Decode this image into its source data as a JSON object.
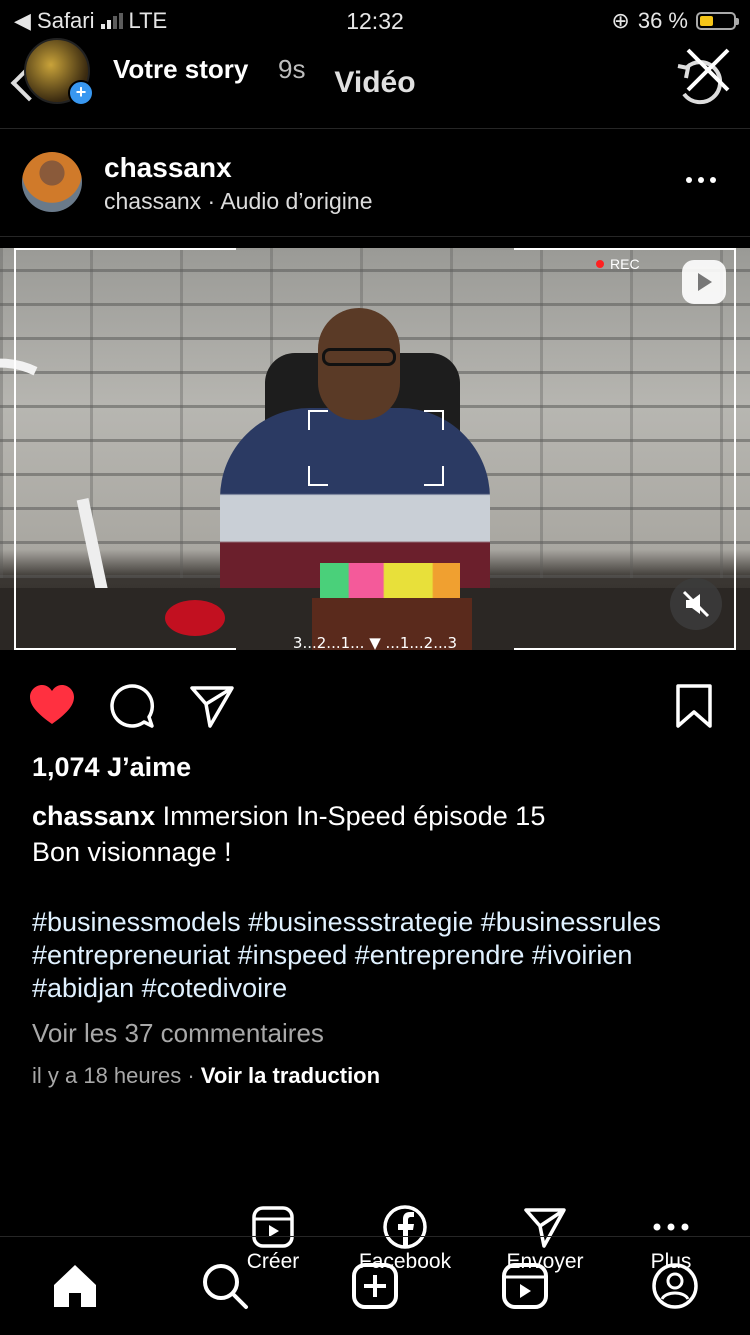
{
  "status_bar": {
    "back_app": "◀ Safari",
    "network": "LTE",
    "time": "12:32",
    "battery": "36 %",
    "battery_level": 0.36
  },
  "story_header": {
    "label": "Votre story",
    "elapsed": "9s",
    "title": "Vidéo"
  },
  "post": {
    "username": "chassanx",
    "subtitle": "chassanx · Audio d’origine",
    "video": {
      "rec_label": "REC",
      "countdown": "3...2...1...  ▼  ...1...2...3"
    },
    "likes": "1,074 J’aime",
    "caption_user": "chassanx",
    "caption_text": "Immersion In-Speed  épisode 15",
    "caption_line2": "Bon visionnage !",
    "hashtags_line1": "#businessmodels #businessstrategie #businessrules",
    "hashtags_line2": "#entrepreneuriat #inspeed  #entreprendre #ivoirien",
    "hashtags_line3": "#abidjan #cotedivoire",
    "comments_link": "Voir les 37 commentaires",
    "timestamp": "il y a 18 heures",
    "translate_link": "Voir la traduction"
  },
  "share_row": [
    {
      "label": "Créer",
      "icon": "reels-icon"
    },
    {
      "label": "Facebook",
      "icon": "facebook-icon"
    },
    {
      "label": "Envoyer",
      "icon": "send-icon"
    },
    {
      "label": "Plus",
      "icon": "more-icon"
    }
  ],
  "tab_bar": [
    {
      "icon": "home-icon"
    },
    {
      "icon": "search-icon"
    },
    {
      "icon": "new-post-icon"
    },
    {
      "icon": "reels-tab-icon"
    },
    {
      "icon": "profile-icon"
    }
  ],
  "colors": {
    "like": "#ff3040",
    "accent_blue": "#3897f0",
    "battery": "#f5c518",
    "hashtag": "#e0f1ff"
  }
}
